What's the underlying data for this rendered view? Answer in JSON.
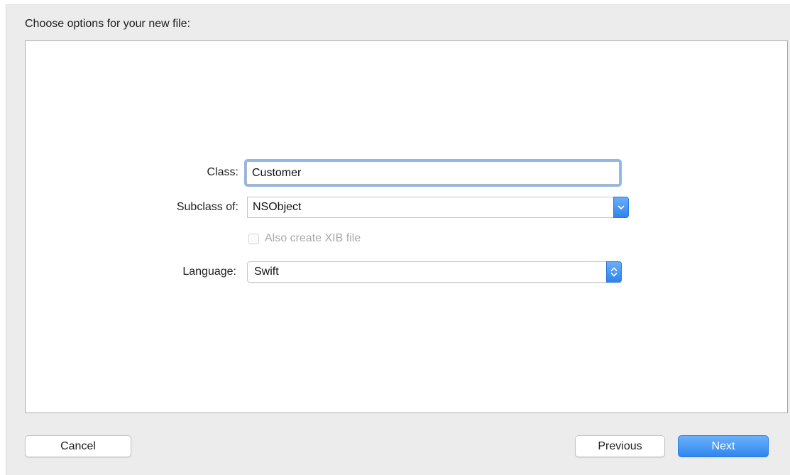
{
  "sheet": {
    "title": "Choose options for your new file:"
  },
  "form": {
    "class_label": "Class:",
    "class_value": "Customer",
    "subclass_label": "Subclass of:",
    "subclass_value": "NSObject",
    "xib_checkbox_label": "Also create XIB file",
    "xib_checkbox_checked": false,
    "xib_checkbox_enabled": false,
    "language_label": "Language:",
    "language_value": "Swift"
  },
  "buttons": {
    "cancel": "Cancel",
    "previous": "Previous",
    "next": "Next"
  },
  "icons": {
    "subclass_dropdown": "chevron-down-icon",
    "language_popup": "up-down-arrows-icon"
  },
  "colors": {
    "accent": "#3b8ff2",
    "focus_ring": "#8fb7ec",
    "sheet_background": "#ececec"
  }
}
